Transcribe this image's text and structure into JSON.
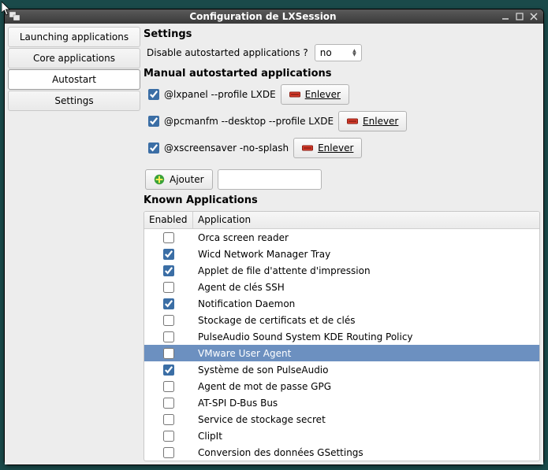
{
  "window": {
    "title": "Configuration de LXSession"
  },
  "sidebar": {
    "items": [
      {
        "label": "Launching applications"
      },
      {
        "label": "Core applications"
      },
      {
        "label": "Autostart"
      },
      {
        "label": "Settings"
      }
    ],
    "selected_index": 2
  },
  "settings": {
    "heading": "Settings",
    "disable_label": "Disable autostarted applications ?",
    "disable_value": "no"
  },
  "manual": {
    "heading": "Manual autostarted applications",
    "items": [
      {
        "checked": true,
        "command": "@lxpanel --profile LXDE",
        "remove_label": "Enlever"
      },
      {
        "checked": true,
        "command": "@pcmanfm --desktop --profile LXDE",
        "remove_label": "Enlever"
      },
      {
        "checked": true,
        "command": "@xscreensaver -no-splash",
        "remove_label": "Enlever"
      }
    ],
    "add_label": "Ajouter",
    "add_value": ""
  },
  "known": {
    "heading": "Known Applications",
    "columns": {
      "enabled": "Enabled",
      "application": "Application"
    },
    "rows": [
      {
        "enabled": false,
        "name": "Orca screen reader"
      },
      {
        "enabled": true,
        "name": "Wicd Network Manager Tray"
      },
      {
        "enabled": true,
        "name": "Applet de file d'attente d'impression"
      },
      {
        "enabled": false,
        "name": "Agent de clés SSH"
      },
      {
        "enabled": true,
        "name": "Notification Daemon"
      },
      {
        "enabled": false,
        "name": "Stockage de certificats et de clés"
      },
      {
        "enabled": false,
        "name": "PulseAudio Sound System KDE Routing Policy"
      },
      {
        "enabled": false,
        "name": "VMware User Agent"
      },
      {
        "enabled": true,
        "name": "Système de son PulseAudio"
      },
      {
        "enabled": false,
        "name": "Agent de mot de passe GPG"
      },
      {
        "enabled": false,
        "name": "AT-SPI D-Bus Bus"
      },
      {
        "enabled": false,
        "name": "Service de stockage secret"
      },
      {
        "enabled": false,
        "name": "ClipIt"
      },
      {
        "enabled": false,
        "name": "Conversion des données GSettings"
      }
    ],
    "selected_index": 7
  }
}
